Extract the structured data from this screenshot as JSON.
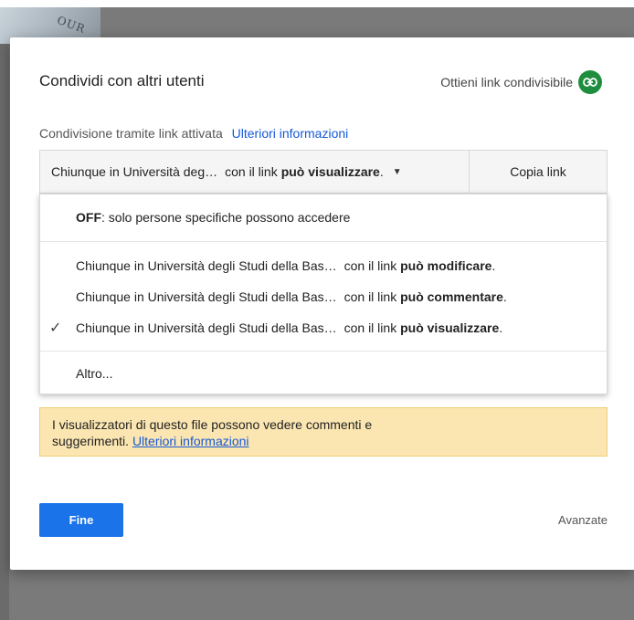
{
  "dialog": {
    "title": "Condividi con altri utenti",
    "get_link": {
      "label": "Ottieni link condivisibile",
      "icon": "link-icon",
      "icon_color": "#1e8e3e"
    },
    "status": {
      "text": "Condivisione tramite link attivata",
      "more_link": "Ulteriori informazioni"
    },
    "selector": {
      "prefix": "Chiunque in Università deg…",
      "middle": "con il link",
      "permission": "può visualizzare",
      "suffix": ".",
      "caret_icon": "caret-down-icon"
    },
    "copy_link_label": "Copia link",
    "menu": {
      "off": {
        "bold": "OFF",
        "rest": ": solo persone specifiche possono accedere"
      },
      "options": [
        {
          "who": "Chiunque in Università degli Studi della Bas…",
          "middle": "con il link",
          "permission": "può modificare",
          "suffix": ".",
          "selected": false
        },
        {
          "who": "Chiunque in Università degli Studi della Bas…",
          "middle": "con il link",
          "permission": "può commentare",
          "suffix": ".",
          "selected": false
        },
        {
          "who": "Chiunque in Università degli Studi della Bas…",
          "middle": "con il link",
          "permission": "può visualizzare",
          "suffix": ".",
          "selected": true
        }
      ],
      "check_symbol": "✓",
      "more": "Altro..."
    },
    "notice": {
      "line1": "I visualizzatori di questo file possono vedere commenti e",
      "line2": "suggerimenti.",
      "link": "Ulteriori informazioni",
      "background": "#fbe6b2"
    },
    "done_label": "Fine",
    "done_color": "#1a73e8",
    "advanced_label": "Avanzate"
  },
  "backdrop": {
    "photo_text": "OUR"
  }
}
